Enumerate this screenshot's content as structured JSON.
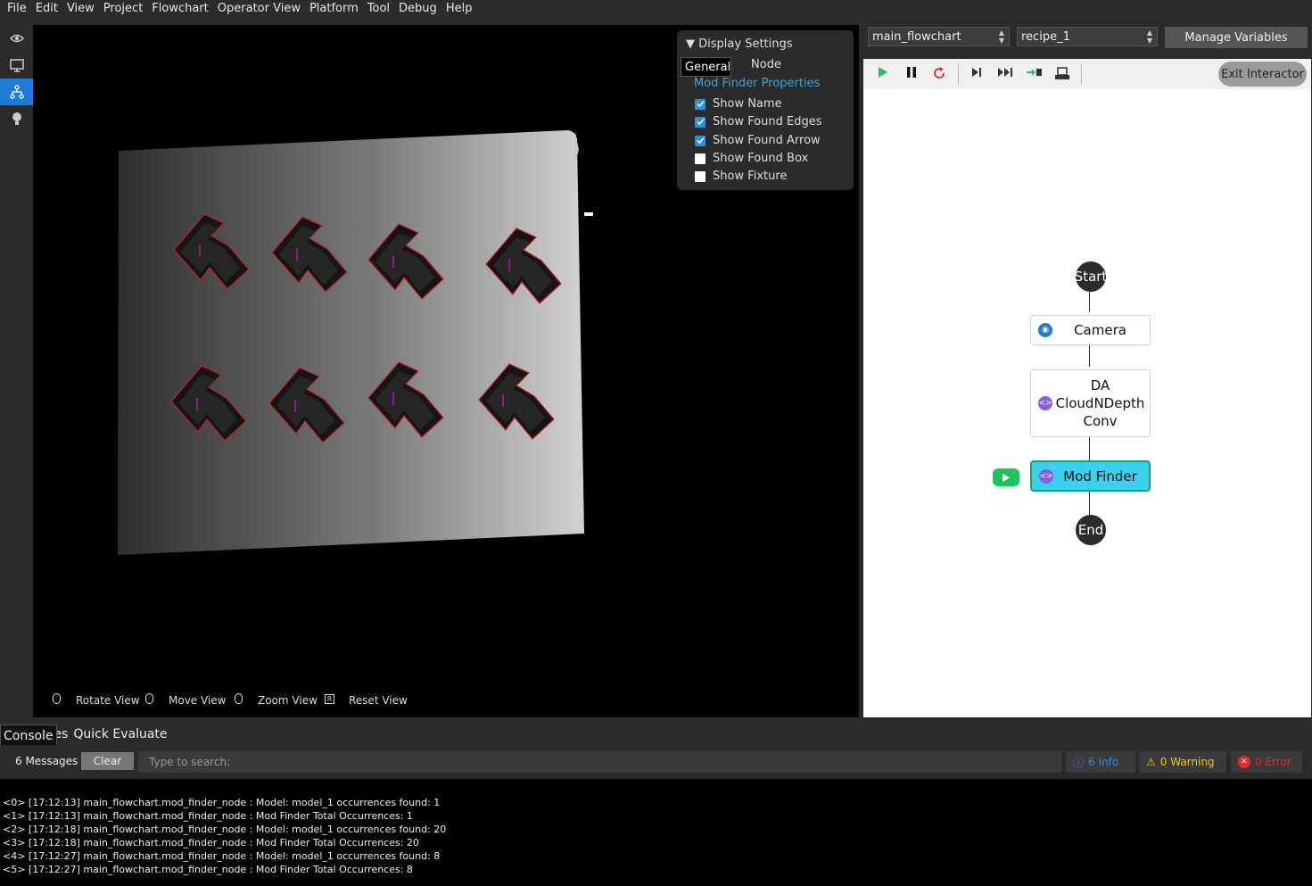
{
  "menu": [
    "File",
    "Edit",
    "View",
    "Project",
    "Flowchart",
    "Operator View",
    "Platform",
    "Tool",
    "Debug",
    "Help"
  ],
  "sidebar_icons": [
    "eye-icon",
    "monitor-icon",
    "flowchart-icon",
    "lightbulb-icon"
  ],
  "display_settings": {
    "title": "Display Settings",
    "tabs": [
      "Node",
      "General"
    ],
    "section": "Mod Finder Properties",
    "options": [
      {
        "label": "Show Name",
        "checked": true
      },
      {
        "label": "Show Found Edges",
        "checked": true
      },
      {
        "label": "Show Found Arrow",
        "checked": true
      },
      {
        "label": "Show Found Box",
        "checked": false
      },
      {
        "label": "Show Fixture",
        "checked": false
      }
    ]
  },
  "detections": [
    "model_1",
    "model_1",
    "model_1",
    "model_1",
    "model_1",
    "model_1",
    "model_1",
    "model_1"
  ],
  "view_hints": [
    "Rotate View",
    "Move View",
    "Zoom View",
    "Reset View"
  ],
  "flowchart_select": "main_flowchart",
  "recipe_select": "recipe_1",
  "manage_variables": "Manage Variables",
  "exit_interactor": "Exit Interactor",
  "flow": {
    "start": "Start",
    "end": "End",
    "camera": "Camera",
    "conv": [
      "DA",
      "CloudNDepth",
      "Conv"
    ],
    "modfinder": "Mod Finder"
  },
  "bottom_tabs": [
    "Console",
    "Recipes",
    "Quick Evaluate"
  ],
  "message_count": "6 Messages",
  "clear": "Clear",
  "search_placeholder": "Type to search:",
  "info": "6 Info",
  "warning": "0 Warning",
  "error": "0 Error",
  "colors": {
    "accent": "#1e7bd6",
    "info": "#2d8fe0",
    "warning": "#f5c518",
    "error": "#e02b2b",
    "node_active": "#3ad0ee",
    "play": "#1dc45a"
  },
  "log": [
    "<0> [17:12:13] main_flowchart.mod_finder_node : Model: model_1 occurrences found: 1",
    "<1> [17:12:13] main_flowchart.mod_finder_node : Mod Finder Total Occurrences: 1",
    "<2> [17:12:18] main_flowchart.mod_finder_node : Model: model_1 occurrences found: 20",
    "<3> [17:12:18] main_flowchart.mod_finder_node : Mod Finder Total Occurrences: 20",
    "<4> [17:12:27] main_flowchart.mod_finder_node : Model: model_1 occurrences found: 8",
    "<5> [17:12:27] main_flowchart.mod_finder_node : Mod Finder Total Occurrences: 8"
  ]
}
